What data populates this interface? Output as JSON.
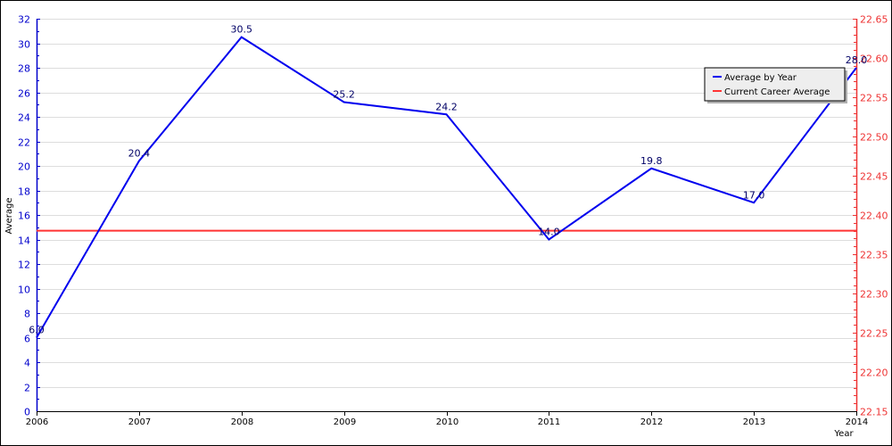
{
  "chart_data": {
    "type": "line",
    "title": "",
    "xlabel": "Year",
    "ylabel": "Average",
    "y2label": "",
    "categories": [
      "2006",
      "2007",
      "2008",
      "2009",
      "2010",
      "2011",
      "2012",
      "2013",
      "2014"
    ],
    "series": [
      {
        "name": "Average by Year",
        "axis": "left",
        "color": "#0000ee",
        "values": [
          6.0,
          20.4,
          30.5,
          25.2,
          24.2,
          14.0,
          19.8,
          17.0,
          28.0
        ],
        "labels": [
          "6.0",
          "20.4",
          "30.5",
          "25.2",
          "24.2",
          "14.0",
          "19.8",
          "17.0",
          "28.0"
        ]
      },
      {
        "name": "Current Career Average",
        "axis": "right",
        "color": "#ff3333",
        "value": 22.38
      }
    ],
    "ylim": [
      0,
      32
    ],
    "yticks": [
      "0",
      "2",
      "4",
      "6",
      "8",
      "10",
      "12",
      "14",
      "16",
      "18",
      "20",
      "22",
      "24",
      "26",
      "28",
      "30",
      "32"
    ],
    "y2lim": [
      22.15,
      22.65
    ],
    "y2ticks": [
      "22.15",
      "22.20",
      "22.25",
      "22.30",
      "22.35",
      "22.40",
      "22.45",
      "22.50",
      "22.55",
      "22.60",
      "22.65"
    ],
    "grid": true,
    "legend_position": "top-right",
    "colors": {
      "left_axis": "#0000cc",
      "right_axis": "#ee3333",
      "grid": "#dddddd"
    }
  }
}
